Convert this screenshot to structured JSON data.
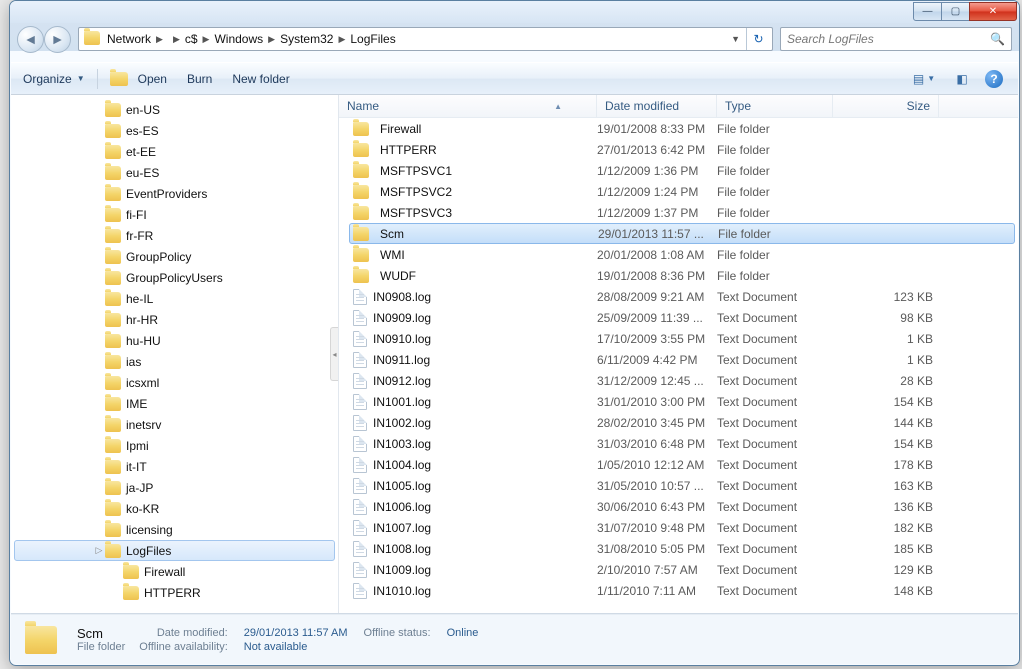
{
  "titlebar": {
    "min": "—",
    "max": "▢",
    "close": "✕"
  },
  "breadcrumbs": [
    "Network",
    "",
    "c$",
    "Windows",
    "System32",
    "LogFiles"
  ],
  "search": {
    "placeholder": "Search LogFiles"
  },
  "toolbar": {
    "organize": "Organize",
    "open": "Open",
    "burn": "Burn",
    "newfolder": "New folder"
  },
  "tree": [
    {
      "label": "en-US",
      "indent": 82
    },
    {
      "label": "es-ES",
      "indent": 82
    },
    {
      "label": "et-EE",
      "indent": 82
    },
    {
      "label": "eu-ES",
      "indent": 82
    },
    {
      "label": "EventProviders",
      "indent": 82
    },
    {
      "label": "fi-FI",
      "indent": 82
    },
    {
      "label": "fr-FR",
      "indent": 82
    },
    {
      "label": "GroupPolicy",
      "indent": 82
    },
    {
      "label": "GroupPolicyUsers",
      "indent": 82
    },
    {
      "label": "he-IL",
      "indent": 82
    },
    {
      "label": "hr-HR",
      "indent": 82
    },
    {
      "label": "hu-HU",
      "indent": 82
    },
    {
      "label": "ias",
      "indent": 82
    },
    {
      "label": "icsxml",
      "indent": 82
    },
    {
      "label": "IME",
      "indent": 82
    },
    {
      "label": "inetsrv",
      "indent": 82
    },
    {
      "label": "Ipmi",
      "indent": 82
    },
    {
      "label": "it-IT",
      "indent": 82
    },
    {
      "label": "ja-JP",
      "indent": 82
    },
    {
      "label": "ko-KR",
      "indent": 82
    },
    {
      "label": "licensing",
      "indent": 82
    },
    {
      "label": "LogFiles",
      "indent": 82,
      "sel": true,
      "tw": "▷"
    },
    {
      "label": "Firewall",
      "indent": 100
    },
    {
      "label": "HTTPERR",
      "indent": 100
    }
  ],
  "columns": {
    "name": "Name",
    "date": "Date modified",
    "type": "Type",
    "size": "Size"
  },
  "files": [
    {
      "icon": "folder",
      "name": "Firewall",
      "date": "19/01/2008 8:33 PM",
      "type": "File folder",
      "size": ""
    },
    {
      "icon": "folder",
      "name": "HTTPERR",
      "date": "27/01/2013 6:42 PM",
      "type": "File folder",
      "size": ""
    },
    {
      "icon": "folder",
      "name": "MSFTPSVC1",
      "date": "1/12/2009 1:36 PM",
      "type": "File folder",
      "size": ""
    },
    {
      "icon": "folder",
      "name": "MSFTPSVC2",
      "date": "1/12/2009 1:24 PM",
      "type": "File folder",
      "size": ""
    },
    {
      "icon": "folder",
      "name": "MSFTPSVC3",
      "date": "1/12/2009 1:37 PM",
      "type": "File folder",
      "size": ""
    },
    {
      "icon": "folder",
      "name": "Scm",
      "date": "29/01/2013 11:57 ...",
      "type": "File folder",
      "size": "",
      "sel": true
    },
    {
      "icon": "folder",
      "name": "WMI",
      "date": "20/01/2008 1:08 AM",
      "type": "File folder",
      "size": ""
    },
    {
      "icon": "folder",
      "name": "WUDF",
      "date": "19/01/2008 8:36 PM",
      "type": "File folder",
      "size": ""
    },
    {
      "icon": "doc",
      "name": "IN0908.log",
      "date": "28/08/2009 9:21 AM",
      "type": "Text Document",
      "size": "123 KB"
    },
    {
      "icon": "doc",
      "name": "IN0909.log",
      "date": "25/09/2009 11:39 ...",
      "type": "Text Document",
      "size": "98 KB"
    },
    {
      "icon": "doc",
      "name": "IN0910.log",
      "date": "17/10/2009 3:55 PM",
      "type": "Text Document",
      "size": "1 KB"
    },
    {
      "icon": "doc",
      "name": "IN0911.log",
      "date": "6/11/2009 4:42 PM",
      "type": "Text Document",
      "size": "1 KB"
    },
    {
      "icon": "doc",
      "name": "IN0912.log",
      "date": "31/12/2009 12:45 ...",
      "type": "Text Document",
      "size": "28 KB"
    },
    {
      "icon": "doc",
      "name": "IN1001.log",
      "date": "31/01/2010 3:00 PM",
      "type": "Text Document",
      "size": "154 KB"
    },
    {
      "icon": "doc",
      "name": "IN1002.log",
      "date": "28/02/2010 3:45 PM",
      "type": "Text Document",
      "size": "144 KB"
    },
    {
      "icon": "doc",
      "name": "IN1003.log",
      "date": "31/03/2010 6:48 PM",
      "type": "Text Document",
      "size": "154 KB"
    },
    {
      "icon": "doc",
      "name": "IN1004.log",
      "date": "1/05/2010 12:12 AM",
      "type": "Text Document",
      "size": "178 KB"
    },
    {
      "icon": "doc",
      "name": "IN1005.log",
      "date": "31/05/2010 10:57 ...",
      "type": "Text Document",
      "size": "163 KB"
    },
    {
      "icon": "doc",
      "name": "IN1006.log",
      "date": "30/06/2010 6:43 PM",
      "type": "Text Document",
      "size": "136 KB"
    },
    {
      "icon": "doc",
      "name": "IN1007.log",
      "date": "31/07/2010 9:48 PM",
      "type": "Text Document",
      "size": "182 KB"
    },
    {
      "icon": "doc",
      "name": "IN1008.log",
      "date": "31/08/2010 5:05 PM",
      "type": "Text Document",
      "size": "185 KB"
    },
    {
      "icon": "doc",
      "name": "IN1009.log",
      "date": "2/10/2010 7:57 AM",
      "type": "Text Document",
      "size": "129 KB"
    },
    {
      "icon": "doc",
      "name": "IN1010.log",
      "date": "1/11/2010 7:11 AM",
      "type": "Text Document",
      "size": "148 KB"
    }
  ],
  "details": {
    "title": "Scm",
    "kind": "File folder",
    "dm_lab": "Date modified:",
    "dm_val": "29/01/2013 11:57 AM",
    "oa_lab": "Offline availability:",
    "oa_val": "Not available",
    "os_lab": "Offline status:",
    "os_val": "Online"
  }
}
